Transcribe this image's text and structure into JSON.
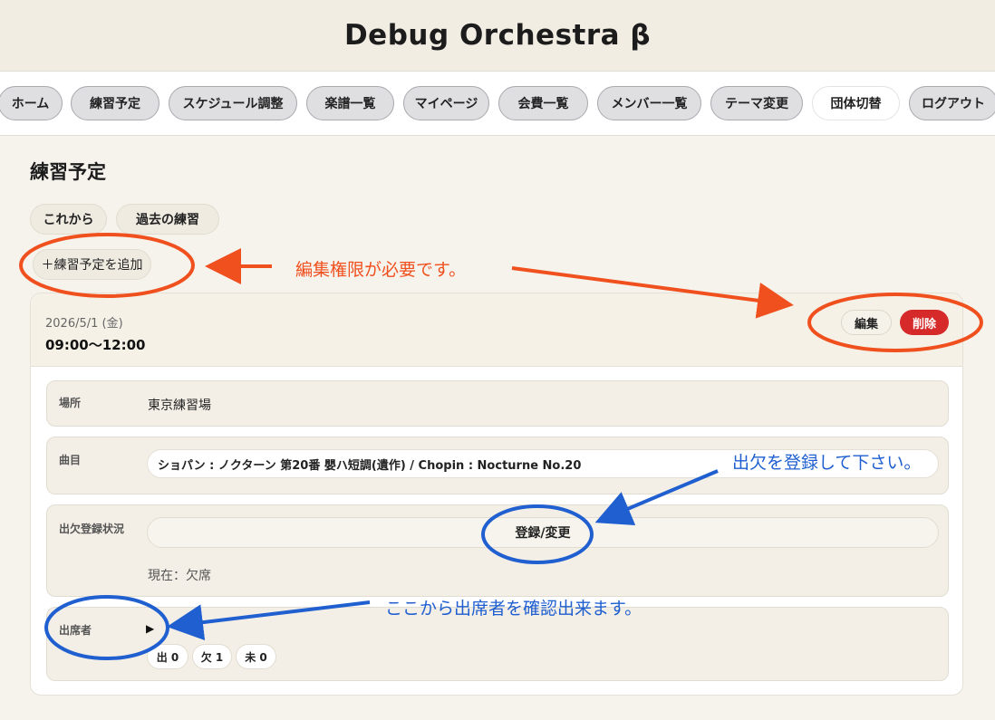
{
  "app": {
    "title": "Debug Orchestra β"
  },
  "nav": {
    "items": [
      {
        "label": "ホーム"
      },
      {
        "label": "練習予定"
      },
      {
        "label": "スケジュール調整"
      },
      {
        "label": "楽譜一覧"
      },
      {
        "label": "マイページ"
      },
      {
        "label": "会費一覧"
      },
      {
        "label": "メンバー一覧"
      },
      {
        "label": "テーマ変更"
      },
      {
        "label": "団体切替",
        "active": true
      },
      {
        "label": "ログアウト"
      }
    ]
  },
  "page": {
    "title": "練習予定",
    "filters": [
      {
        "label": "これから"
      },
      {
        "label": "過去の練習"
      }
    ],
    "add_button": "＋練習予定を追加"
  },
  "event": {
    "date": "2026/5/1 (金)",
    "time": "09:00〜12:00",
    "edit_label": "編集",
    "delete_label": "削除",
    "location": {
      "label": "場所",
      "value": "東京練習場"
    },
    "program": {
      "label": "曲目",
      "pieces": [
        "ショパン : ノクターン 第20番 嬰ハ短調(遺作) / Chopin : Nocturne No.20"
      ]
    },
    "attendance": {
      "label": "出欠登録状況",
      "register_button": "登録/変更",
      "current_status": "現在：欠席"
    },
    "attendees": {
      "label": "出席者",
      "toggle": "▶",
      "counts": [
        "出 0",
        "欠 1",
        "未 0"
      ]
    }
  },
  "annotations": {
    "permission_note": "編集権限が必要です。",
    "register_note": "出欠を登録して下さい。",
    "attendees_note": "ここから出席者を確認出来ます。",
    "colors": {
      "red": "#f0501e",
      "blue": "#1f5fd0"
    }
  }
}
